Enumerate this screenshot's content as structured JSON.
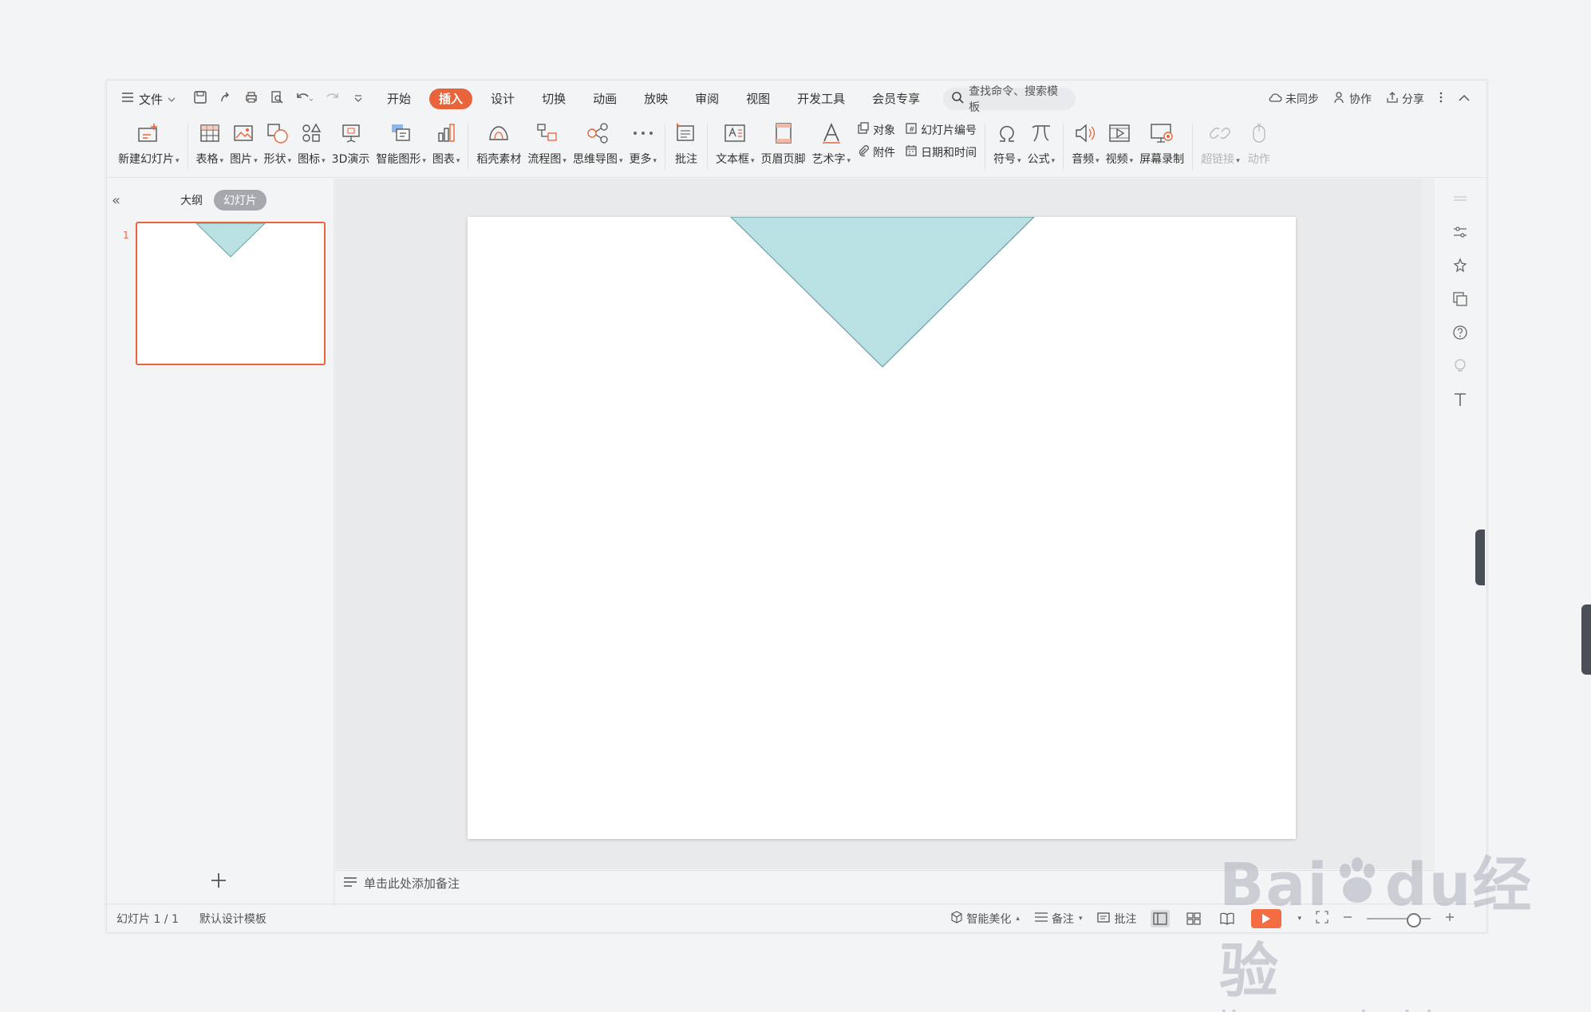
{
  "menu": {
    "file_label": "文件",
    "tabs": [
      {
        "label": "开始"
      },
      {
        "label": "插入"
      },
      {
        "label": "设计"
      },
      {
        "label": "切换"
      },
      {
        "label": "动画"
      },
      {
        "label": "放映"
      },
      {
        "label": "审阅"
      },
      {
        "label": "视图"
      },
      {
        "label": "开发工具"
      },
      {
        "label": "会员专享"
      }
    ],
    "active_tab": "插入",
    "search_placeholder": "查找命令、搜索模板",
    "right": {
      "sync": "未同步",
      "collab": "协作",
      "share": "分享"
    }
  },
  "ribbon": {
    "new_slide": "新建幻灯片",
    "table": "表格",
    "picture": "图片",
    "shape": "形状",
    "icon": "图标",
    "demo3d": "3D演示",
    "smart_graphic": "智能图形",
    "chart": "图表",
    "docer": "稻壳素材",
    "flowchart": "流程图",
    "mindmap": "思维导图",
    "more": "更多",
    "comment": "批注",
    "textbox": "文本框",
    "header_footer": "页眉页脚",
    "wordart": "艺术字",
    "object": "对象",
    "slide_number": "幻灯片编号",
    "attachment": "附件",
    "datetime": "日期和时间",
    "symbol": "符号",
    "formula": "公式",
    "audio": "音频",
    "video": "视频",
    "screen_record": "屏幕录制",
    "hyperlink": "超链接",
    "action": "动作"
  },
  "left_panel": {
    "outline_tab": "大纲",
    "slides_tab": "幻灯片",
    "thumb_number": "1"
  },
  "notes_placeholder": "单击此处添加备注",
  "status": {
    "slide_counter": "幻灯片 1 / 1",
    "template": "默认设计模板",
    "beautify": "智能美化",
    "notes": "备注",
    "comment": "批注"
  },
  "watermark": {
    "brand": "Bai",
    "brand_du": "du",
    "brand_cn": "经验",
    "domain": "jingyan.baidu.com"
  },
  "colors": {
    "accent": "#e8643a",
    "triangle_fill": "#b9e0e3",
    "triangle_stroke": "#6f9ea3"
  }
}
